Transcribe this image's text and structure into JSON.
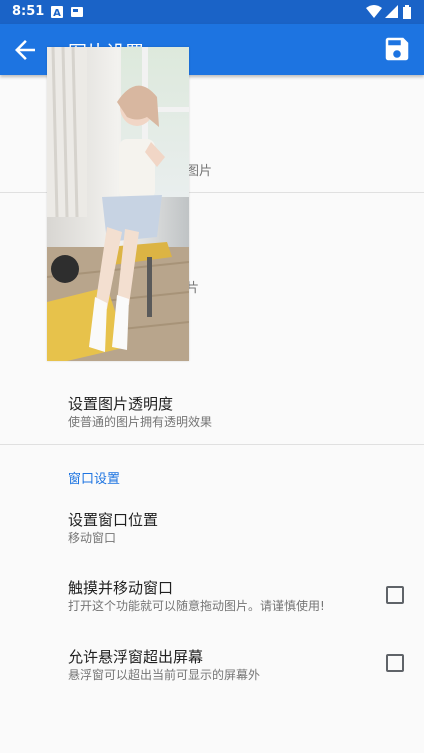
{
  "status_bar": {
    "time": "8:51",
    "icons": [
      "a-notification-icon",
      "card-notification-icon",
      "wifi-icon",
      "signal-icon",
      "battery-icon"
    ]
  },
  "app_bar": {
    "title": "图片设置",
    "back_icon": "arrow-back-icon",
    "save_icon": "save-icon",
    "color": "#1d74e1"
  },
  "items_hidden": [
    {
      "title_tail": "图片"
    },
    {
      "title_tail": "片"
    }
  ],
  "items": {
    "opacity": {
      "title": "设置图片透明度",
      "subtitle": "使普通的图片拥有透明效果"
    },
    "position": {
      "title": "设置窗口位置",
      "subtitle": "移动窗口"
    },
    "touch_move": {
      "title": "触摸并移动窗口",
      "subtitle": "打开这个功能就可以随意拖动图片。请谨慎使用!",
      "checked": false
    },
    "overflow": {
      "title": "允许悬浮窗超出屏幕",
      "subtitle": "悬浮窗可以超出当前可显示的屏幕外",
      "checked": false
    }
  },
  "section": {
    "window_settings": "窗口设置"
  },
  "floating_image": {
    "description": "photo"
  }
}
